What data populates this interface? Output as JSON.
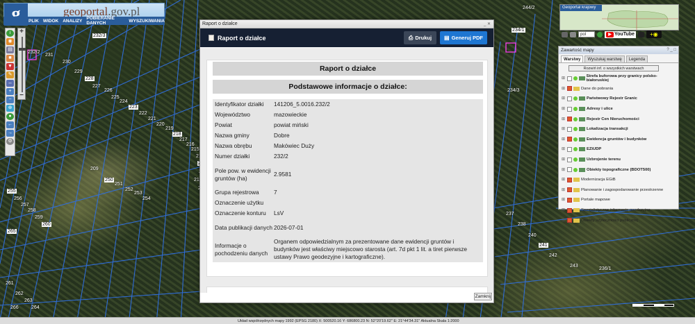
{
  "app": {
    "logo_letter": "g",
    "logo_prefix": "geo",
    "logo_name": "portal",
    "logo_domain": ".gov.pl",
    "menu": [
      "PLIK",
      "WIDOK",
      "ANALIZY",
      "POBIERANIE DANYCH",
      "WYSZUKIWANIA"
    ]
  },
  "minimap": {
    "title": "Geoportal krajowy"
  },
  "right_toolbar": {
    "language": "pol",
    "youtube_label": "YouTube"
  },
  "layers_panel": {
    "title": "Zawartość mapy",
    "tabs": [
      "Warstwy",
      "Wyszukaj warstwę",
      "Legenda"
    ],
    "expand_button": "Rozwiń inf. o wszystkich warstwach",
    "layers": [
      {
        "name": "Strefa buforowa przy granicy polsko-białoruskiej",
        "checked": false,
        "bold": true,
        "folder": false
      },
      {
        "name": "Dane do pobrania",
        "checked": true,
        "bold": false,
        "folder": true
      },
      {
        "name": "Państwowy Rejestr Granic",
        "checked": false,
        "bold": true,
        "folder": false
      },
      {
        "name": "Adresy i ulice",
        "checked": false,
        "bold": true,
        "folder": false
      },
      {
        "name": "Rejestr Cen Nieruchomości",
        "checked": true,
        "bold": true,
        "folder": false
      },
      {
        "name": "Lokalizacja transakcji",
        "checked": false,
        "bold": true,
        "folder": false
      },
      {
        "name": "Ewidencja gruntów i budynków",
        "checked": true,
        "bold": true,
        "folder": false
      },
      {
        "name": "EZiUDP",
        "checked": false,
        "bold": true,
        "folder": false
      },
      {
        "name": "Uzbrojenie terenu",
        "checked": false,
        "bold": true,
        "folder": false
      },
      {
        "name": "Obiekty topograficzne (BDOT500)",
        "checked": false,
        "bold": true,
        "folder": false
      },
      {
        "name": "Modernizacja EGiB",
        "checked": true,
        "bold": false,
        "folder": true
      },
      {
        "name": "Planowanie i zagospodarowanie przestrzenne",
        "checked": true,
        "bold": false,
        "folder": true
      },
      {
        "name": "Portale mapowe",
        "checked": true,
        "bold": false,
        "folder": true
      },
      {
        "name": "Specjalistyczne informacje geodezyjne",
        "checked": true,
        "bold": false,
        "folder": true
      },
      {
        "name": "Obiekty użyteczności publicznej",
        "checked": true,
        "bold": false,
        "folder": true
      }
    ]
  },
  "dialog": {
    "window_title": "Raport o działce",
    "header_title": "Raport o działce",
    "print_label": "Drukuj",
    "pdf_label": "Generuj PDF",
    "report_title": "Raport o działce",
    "section_title": "Podstawowe informacje o działce:",
    "rows": [
      {
        "key": "Identyfikator działki",
        "value": "141206_5.0016.232/2"
      },
      {
        "key": "Województwo",
        "value": "mazowieckie"
      },
      {
        "key": "Powiat",
        "value": "powiat miński"
      },
      {
        "key": "Nazwa gminy",
        "value": "Dobre"
      },
      {
        "key": "Nazwa obrębu",
        "value": "Makówiec Duży"
      },
      {
        "key": "Numer działki",
        "value": "232/2"
      },
      {
        "key": "Pole pow. w ewidencji gruntów (ha)",
        "value": "2.9581"
      },
      {
        "key": "Grupa rejestrowa",
        "value": "7"
      },
      {
        "key": "Oznaczenie użytku",
        "value": ""
      },
      {
        "key": "Oznaczenie konturu",
        "value": "LsV"
      },
      {
        "key": "Data publikacji danych",
        "value": "2026-07-01"
      },
      {
        "key": "Informacje o pochodzeniu danych",
        "value": "Organem odpowiedzialnym za prezentowane dane ewidencji gruntów i budynków jest właściwy miejscowo starosta (art. 7d pkt 1 lit. a tiret pierwsze ustawy Prawo geodezyjne i kartograficzne)."
      }
    ],
    "close_label": "Zamknij"
  },
  "statusbar": {
    "text": "Układ współrzędnych mapy 1992 (EPSG 2180)   X: 500520.16 Y: 686800.23   N: 52°20'19.62\" E: 21°44'34.31\"   Aktualna Skala 1:2000"
  },
  "map_labels": [
    "232/3",
    "232/2",
    "231",
    "230",
    "229",
    "228",
    "227",
    "226",
    "225",
    "224",
    "223",
    "222",
    "221",
    "220",
    "219",
    "218",
    "217",
    "216",
    "215",
    "214",
    "213",
    "212",
    "211",
    "210",
    "209",
    "250",
    "251",
    "252",
    "253",
    "254",
    "255",
    "256",
    "257",
    "258",
    "259",
    "260",
    "261",
    "262",
    "263",
    "264",
    "265",
    "266",
    "237",
    "238",
    "240",
    "241",
    "242",
    "243",
    "236/1",
    "234/3",
    "234/1",
    "244/2"
  ]
}
